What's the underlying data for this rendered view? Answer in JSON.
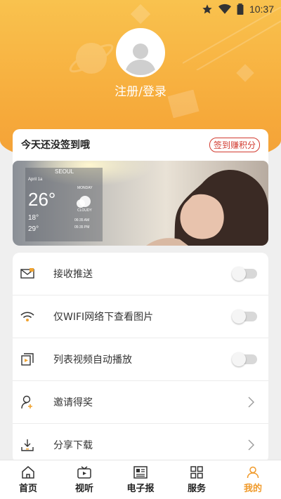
{
  "status_bar": {
    "time": "10:37"
  },
  "profile": {
    "login_text": "注册/登录"
  },
  "checkin": {
    "title": "今天还没签到哦",
    "badge": "签到赚积分"
  },
  "banner": {
    "city": "SEOUL",
    "date": "April 1a",
    "temperature": "26°",
    "weather": "CLOUDY",
    "day": "MONDAY",
    "low": "18°",
    "high": "29°",
    "time1": "06:35 AM",
    "time2": "05:35 PM"
  },
  "settings": {
    "items": [
      {
        "label": "接收推送",
        "control": "toggle",
        "on": false
      },
      {
        "label": "仅WIFI网络下查看图片",
        "control": "toggle",
        "on": false
      },
      {
        "label": "列表视频自动播放",
        "control": "toggle",
        "on": false
      },
      {
        "label": "邀请得奖",
        "control": "chevron"
      },
      {
        "label": "分享下载",
        "control": "chevron"
      }
    ]
  },
  "nav": {
    "items": [
      {
        "label": "首页"
      },
      {
        "label": "视听"
      },
      {
        "label": "电子报"
      },
      {
        "label": "服务"
      },
      {
        "label": "我的"
      }
    ],
    "active_index": 4
  },
  "colors": {
    "accent": "#f09a2a",
    "hero": "#f7b142",
    "badge": "#d23a2f"
  }
}
